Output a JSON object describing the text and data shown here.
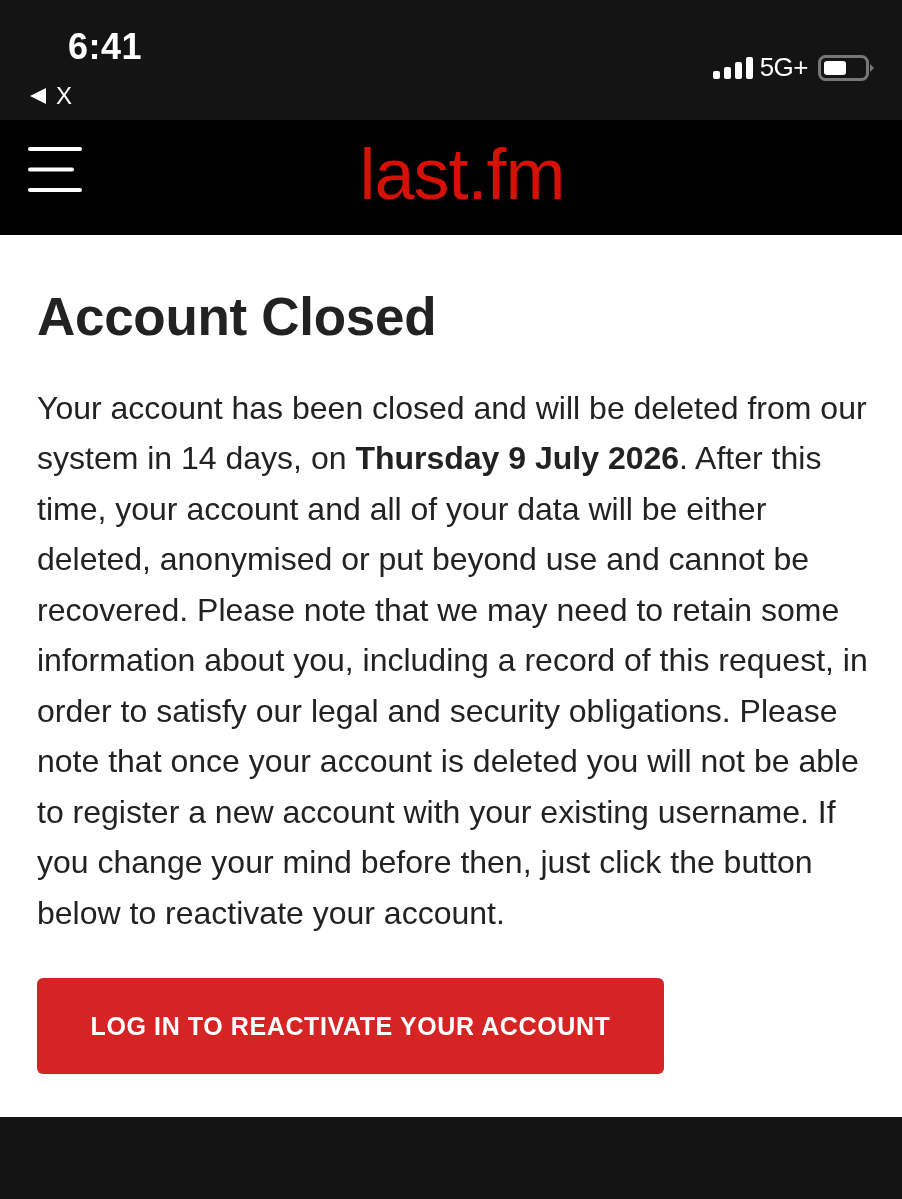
{
  "status_bar": {
    "time": "6:41",
    "back_label": "X",
    "network": "5G+"
  },
  "header": {
    "logo": "last.fm"
  },
  "content": {
    "title": "Account Closed",
    "message": "Your account has been closed and will be deleted from our system in 14 days, on **Thursday 9 July 2026**. After this time, your account and all of your data will be either deleted, anonymised or put beyond use and cannot be recovered. Please note that we may need to retain some information about you, including a record of this request, in order to satisfy our legal and security obligations. Please note that once your account is deleted you will not be able to register a new account with your existing username. If you change your mind before then, just click the button below to reactivate your account.",
    "button": "LOG IN TO REACTIVATE YOUR ACCOUNT"
  }
}
